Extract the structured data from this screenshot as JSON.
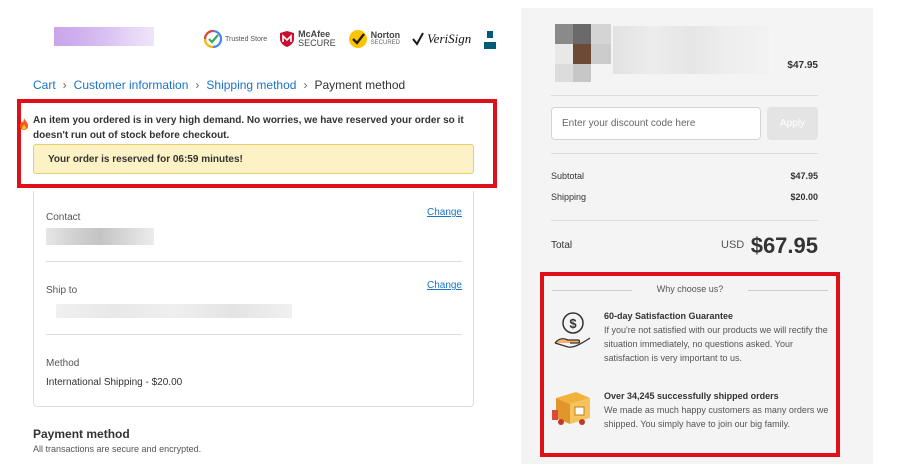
{
  "header": {
    "badges": [
      {
        "icon": "google-check-icon",
        "main": "Trusted Store",
        "sub": ""
      },
      {
        "icon": "mcafee-shield-icon",
        "main": "McAfee",
        "sub": "SECURE"
      },
      {
        "icon": "norton-check-icon",
        "main": "Norton",
        "sub": "SECURED"
      },
      {
        "icon": "verisign-check-icon",
        "main": "VeriSign",
        "sub": ""
      },
      {
        "icon": "bbb-torch-icon",
        "main": "BBB",
        "sub": ""
      }
    ]
  },
  "breadcrumb": {
    "items": [
      "Cart",
      "Customer information",
      "Shipping method"
    ],
    "current": "Payment method",
    "separator": "›"
  },
  "alert": {
    "icon": "fire-icon",
    "message": "An item you ordered is in very high demand. No worries, we have reserved your order so it doesn't run out of stock before checkout.",
    "reserved_text": "Your order is reserved for 06:59 minutes!"
  },
  "review": {
    "contact_label": "Contact",
    "contact_change": "Change",
    "shipto_label": "Ship to",
    "shipto_change": "Change",
    "method_label": "Method",
    "method_value": "International Shipping - $20.00"
  },
  "payment": {
    "title": "Payment method",
    "subtitle": "All transactions are secure and encrypted."
  },
  "order_summary": {
    "product_price": "$47.95",
    "discount_placeholder": "Enter your discount code here",
    "apply_label": "Apply",
    "subtotal_label": "Subtotal",
    "subtotal_value": "$47.95",
    "shipping_label": "Shipping",
    "shipping_value": "$20.00",
    "total_label": "Total",
    "total_currency": "USD",
    "total_value": "$67.95"
  },
  "why_choose": {
    "heading": "Why choose us?",
    "features": [
      {
        "icon": "money-hand-icon",
        "title": "60-day Satisfaction Guarantee",
        "description": "If you're not satisfied with our products we will rectify the situation immediately, no questions asked. Your satisfaction is very important to us."
      },
      {
        "icon": "delivery-truck-icon",
        "title": "Over 34,245 successfully shipped orders",
        "description": "We made as much happy customers as many orders we shipped. You simply have to join our big family."
      }
    ]
  },
  "colors": {
    "link": "#1a73c8",
    "highlight_border": "#e0101a",
    "reserved_bg": "#fdf2c6",
    "sidebar_bg": "#f4f4f4"
  }
}
